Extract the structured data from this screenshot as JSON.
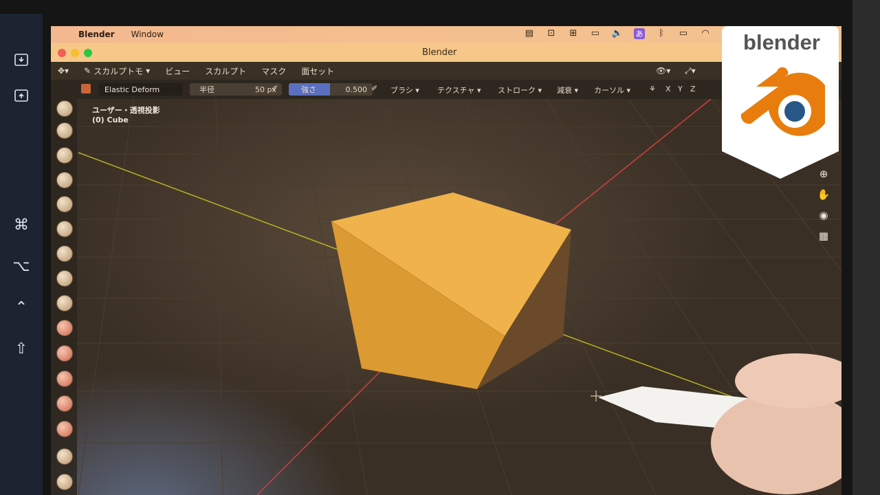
{
  "menubar": {
    "app": "Blender",
    "window_menu": "Window"
  },
  "window": {
    "title": "Blender"
  },
  "header": {
    "mode": "スカルプトモ",
    "view": "ビュー",
    "sculpt": "スカルプト",
    "mask": "マスク",
    "face_sets": "面セット"
  },
  "tool_settings": {
    "brush_name": "Elastic Deform",
    "radius_label": "半径",
    "radius_value": "50 px",
    "strength_label": "強さ",
    "strength_value": "0.500",
    "brush_menu": "ブラシ",
    "texture_menu": "テクスチャ",
    "stroke_menu": "ストローク",
    "falloff_menu": "減衰",
    "cursor_menu": "カーソル",
    "axes": [
      "X",
      "Y",
      "Z"
    ]
  },
  "viewport": {
    "view_label": "ユーザー・透視投影",
    "object_label": "(0) Cube"
  },
  "logo": {
    "wordmark": "blender",
    "brand_color": "#e87d0d",
    "eye_color": "#265787"
  },
  "colors": {
    "cube": "#e8a23c",
    "x_axis": "#e04040",
    "y_axis": "#c8c020"
  }
}
